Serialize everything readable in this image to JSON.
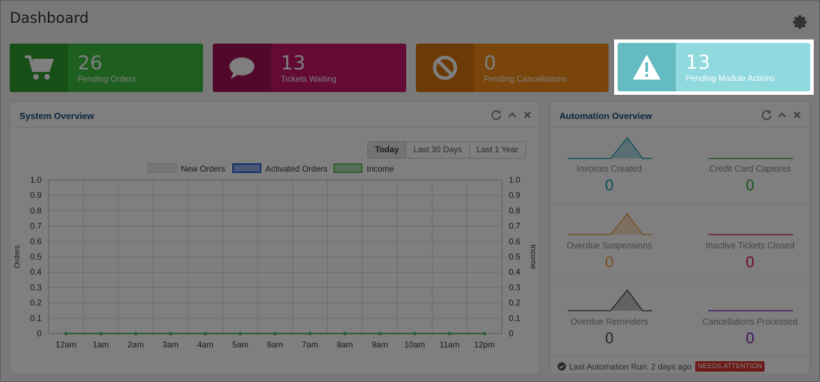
{
  "header": {
    "title": "Dashboard"
  },
  "stats": [
    {
      "count": "26",
      "label": "Pending Orders",
      "icon": "cart-icon"
    },
    {
      "count": "13",
      "label": "Tickets Waiting",
      "icon": "comment-icon"
    },
    {
      "count": "0",
      "label": "Pending Cancellations",
      "icon": "ban-icon"
    },
    {
      "count": "13",
      "label": "Pending Module Actions",
      "icon": "warning-icon"
    }
  ],
  "system_overview": {
    "title": "System Overview",
    "ranges": [
      "Today",
      "Last 30 Days",
      "Last 1 Year"
    ],
    "active_range": "Today"
  },
  "automation_overview": {
    "title": "Automation Overview",
    "items": [
      {
        "label": "Invoices Created",
        "value": "0",
        "color": "#2aa4b6"
      },
      {
        "label": "Credit Card Captures",
        "value": "0",
        "color": "#3ea83e"
      },
      {
        "label": "Overdue Suspensions",
        "value": "0",
        "color": "#f0a34a"
      },
      {
        "label": "Inactive Tickets Closed",
        "value": "0",
        "color": "#d9216e"
      },
      {
        "label": "Overdue Reminders",
        "value": "0",
        "color": "#555555"
      },
      {
        "label": "Cancellations Processed",
        "value": "0",
        "color": "#8a2fc0"
      }
    ],
    "last_run_text": "Last Automation Run: 2 days ago",
    "attention_badge": "NEEDS ATTENTION"
  },
  "chart_data": {
    "type": "line",
    "categories": [
      "12am",
      "1am",
      "2am",
      "3am",
      "4am",
      "5am",
      "6am",
      "7am",
      "8am",
      "9am",
      "10am",
      "11am",
      "12pm"
    ],
    "series": [
      {
        "name": "New Orders",
        "values": [
          0,
          0,
          0,
          0,
          0,
          0,
          0,
          0,
          0,
          0,
          0,
          0,
          0
        ],
        "color": "#dddddd"
      },
      {
        "name": "Activated Orders",
        "values": [
          0,
          0,
          0,
          0,
          0,
          0,
          0,
          0,
          0,
          0,
          0,
          0,
          0
        ],
        "color": "#2b5bd9"
      },
      {
        "name": "Income",
        "values": [
          0,
          0,
          0,
          0,
          0,
          0,
          0,
          0,
          0,
          0,
          0,
          0,
          0
        ],
        "color": "#5cbf5c"
      }
    ],
    "ylabel_left": "Orders",
    "ylabel_right": "Income",
    "ylim": [
      0,
      1.0
    ],
    "yticks": [
      "0",
      "0.1",
      "0.2",
      "0.3",
      "0.4",
      "0.5",
      "0.6",
      "0.7",
      "0.8",
      "0.9",
      "1.0"
    ],
    "legend": "top-center",
    "grid": true
  }
}
